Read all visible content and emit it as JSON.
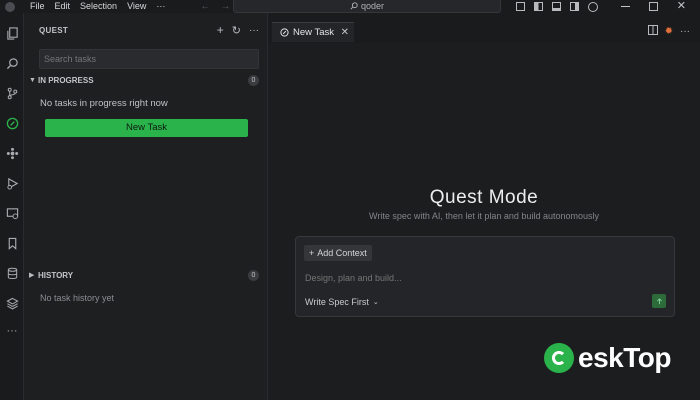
{
  "titlebar": {
    "menu": [
      "File",
      "Edit",
      "Selection",
      "View",
      "···"
    ],
    "search_text": "qoder"
  },
  "sidebar": {
    "title": "QUEST",
    "search_placeholder": "Search tasks",
    "in_progress": {
      "label": "IN PROGRESS",
      "count": "0",
      "empty_text": "No tasks in progress right now",
      "new_task_label": "New Task"
    },
    "history": {
      "label": "HISTORY",
      "count": "0",
      "empty_text": "No task history yet"
    }
  },
  "editor": {
    "tab_label": "New Task",
    "heading": "Quest Mode",
    "subheading": "Write spec with AI, then let it plan and build autonomously",
    "add_context_label": "Add Context",
    "input_placeholder": "Design, plan and build...",
    "mode_select": "Write Spec First"
  },
  "watermark": {
    "text": "eskTop"
  },
  "colors": {
    "accent_green": "#2ab34a",
    "background": "#1c1d1f"
  }
}
